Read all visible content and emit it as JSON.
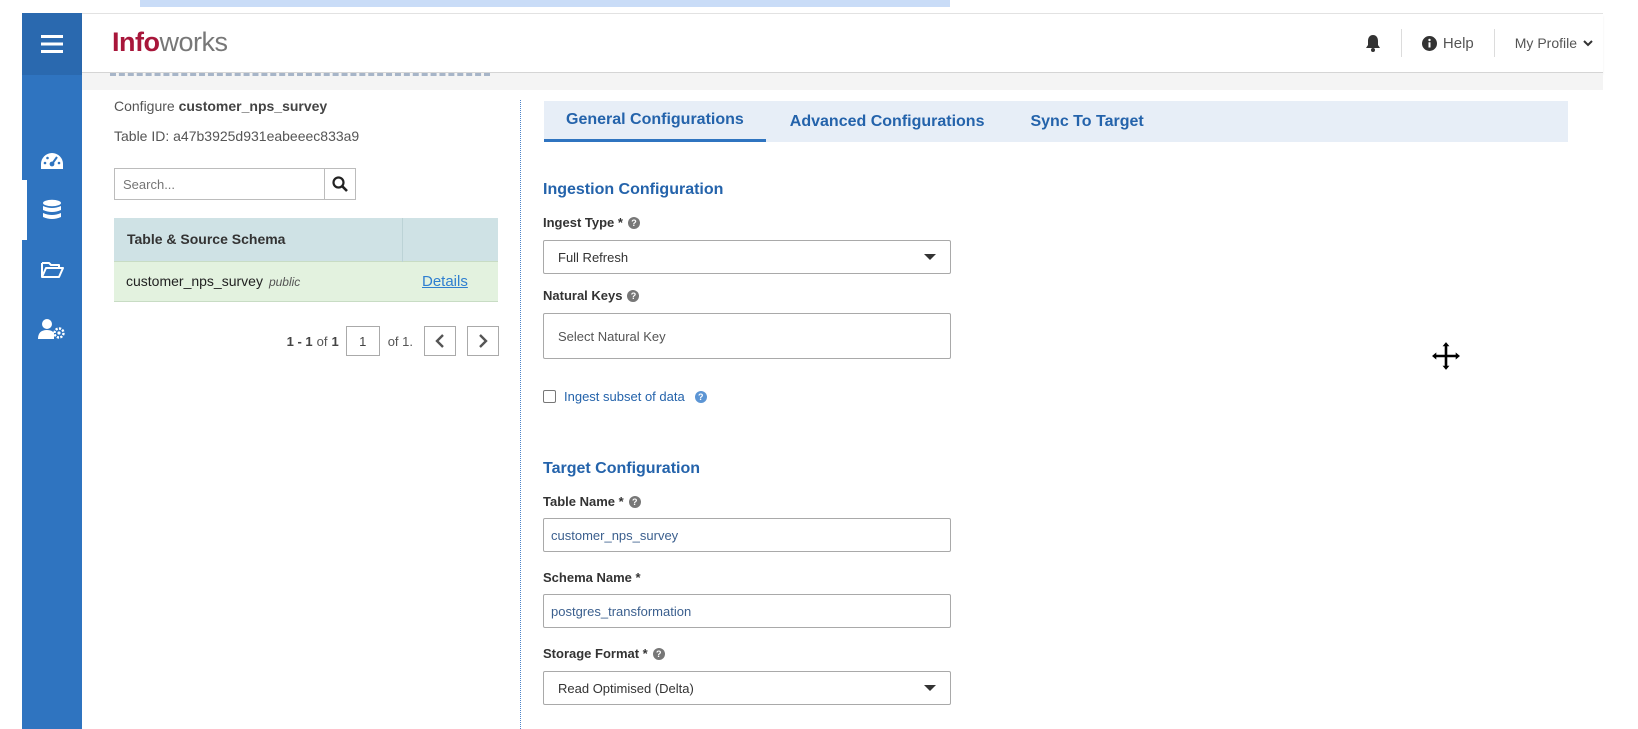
{
  "app": {
    "logo_part1": "Info",
    "logo_part2": "works"
  },
  "header": {
    "help_label": "Help",
    "profile_label": "My Profile"
  },
  "sidebar": {
    "items": [
      {
        "icon": "dashboard-icon"
      },
      {
        "icon": "database-icon",
        "active": true
      },
      {
        "icon": "folder-icon"
      },
      {
        "icon": "user-settings-icon"
      }
    ]
  },
  "left_panel": {
    "configure_prefix": "Configure",
    "table_name": "customer_nps_survey",
    "table_id": "Table ID: a47b3925d931eabeeec833a9",
    "search_placeholder": "Search...",
    "table_header": "Table & Source Schema",
    "rows": [
      {
        "name": "customer_nps_survey",
        "schema": "public",
        "link": "Details"
      }
    ],
    "pager": {
      "range": "1 - 1",
      "of_label": "of",
      "total": "1",
      "page": "1",
      "of_pages": "of 1."
    }
  },
  "tabs": [
    {
      "label": "General Configurations",
      "active": true
    },
    {
      "label": "Advanced Configurations",
      "active": false
    },
    {
      "label": "Sync To Target",
      "active": false
    }
  ],
  "form": {
    "ingestion_title": "Ingestion Configuration",
    "ingest_type_label": "Ingest Type *",
    "ingest_type_value": "Full Refresh",
    "natural_keys_label": "Natural Keys",
    "natural_keys_placeholder": "Select Natural Key",
    "subset_label": "Ingest subset of data",
    "target_title": "Target Configuration",
    "table_name_label": "Table Name *",
    "table_name_value": "customer_nps_survey",
    "schema_name_label": "Schema Name *",
    "schema_name_value": "postgres_transformation",
    "storage_format_label": "Storage Format *",
    "storage_format_value": "Read Optimised (Delta)"
  },
  "colors": {
    "sidebar": "#2f74c0",
    "brand": "#a8163a",
    "accent": "#2463ab",
    "table_header": "#cfe2e5",
    "table_row": "#e3f2df"
  }
}
